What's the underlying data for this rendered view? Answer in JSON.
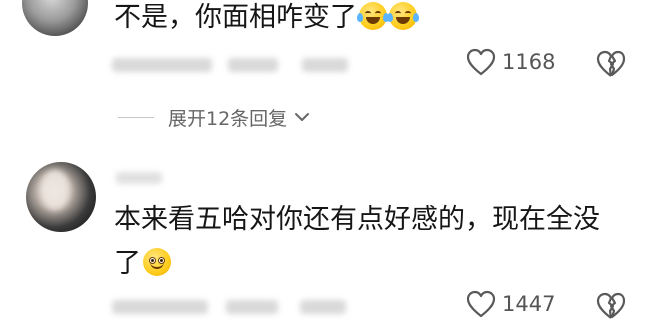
{
  "comments": [
    {
      "text": "不是，你面相咋变了",
      "emojis": [
        "laughing-crying-emoji",
        "laughing-crying-emoji"
      ],
      "likes": "1168",
      "replies_label": "展开12条回复"
    },
    {
      "text_line1": "本来看五哈对你还有点好感的，现在全没",
      "text_line2": "了",
      "emojis": [
        "smiling-sweat-emoji"
      ],
      "likes": "1447"
    }
  ],
  "colors": {
    "text": "#161616",
    "meta": "#666666",
    "icon": "#555555"
  },
  "icons": [
    "heart-outline-icon",
    "broken-heart-icon",
    "chevron-down-icon"
  ]
}
